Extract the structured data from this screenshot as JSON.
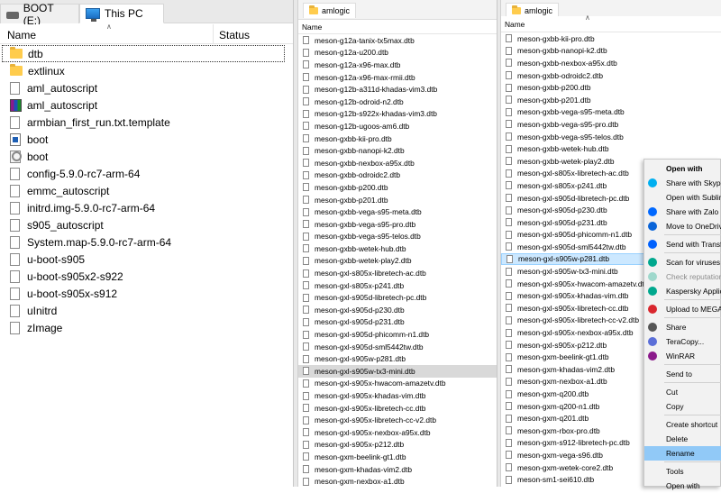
{
  "left": {
    "tabs": [
      "BOOT (E:)",
      "This PC"
    ],
    "columns": [
      "Name",
      "Status"
    ],
    "items": [
      {
        "name": "dtb",
        "type": "folder"
      },
      {
        "name": "extlinux",
        "type": "folder"
      },
      {
        "name": "aml_autoscript",
        "type": "file"
      },
      {
        "name": "aml_autoscript",
        "type": "archive"
      },
      {
        "name": "armbian_first_run.txt.template",
        "type": "file"
      },
      {
        "name": "boot",
        "type": "exe"
      },
      {
        "name": "boot",
        "type": "settings"
      },
      {
        "name": "config-5.9.0-rc7-arm-64",
        "type": "file"
      },
      {
        "name": "emmc_autoscript",
        "type": "file"
      },
      {
        "name": "initrd.img-5.9.0-rc7-arm-64",
        "type": "file"
      },
      {
        "name": "s905_autoscript",
        "type": "file"
      },
      {
        "name": "System.map-5.9.0-rc7-arm-64",
        "type": "file"
      },
      {
        "name": "u-boot-s905",
        "type": "file"
      },
      {
        "name": "u-boot-s905x2-s922",
        "type": "file"
      },
      {
        "name": "u-boot-s905x-s912",
        "type": "file"
      },
      {
        "name": "uInitrd",
        "type": "file"
      },
      {
        "name": "zImage",
        "type": "file"
      }
    ]
  },
  "middle": {
    "tab": "amlogic",
    "column": "Name",
    "items": [
      "meson-g12a-tanix-tx5max.dtb",
      "meson-g12a-u200.dtb",
      "meson-g12a-x96-max.dtb",
      "meson-g12a-x96-max-rmii.dtb",
      "meson-g12b-a311d-khadas-vim3.dtb",
      "meson-g12b-odroid-n2.dtb",
      "meson-g12b-s922x-khadas-vim3.dtb",
      "meson-g12b-ugoos-am6.dtb",
      "meson-gxbb-kii-pro.dtb",
      "meson-gxbb-nanopi-k2.dtb",
      "meson-gxbb-nexbox-a95x.dtb",
      "meson-gxbb-odroidc2.dtb",
      "meson-gxbb-p200.dtb",
      "meson-gxbb-p201.dtb",
      "meson-gxbb-vega-s95-meta.dtb",
      "meson-gxbb-vega-s95-pro.dtb",
      "meson-gxbb-vega-s95-telos.dtb",
      "meson-gxbb-wetek-hub.dtb",
      "meson-gxbb-wetek-play2.dtb",
      "meson-gxl-s805x-libretech-ac.dtb",
      "meson-gxl-s805x-p241.dtb",
      "meson-gxl-s905d-libretech-pc.dtb",
      "meson-gxl-s905d-p230.dtb",
      "meson-gxl-s905d-p231.dtb",
      "meson-gxl-s905d-phicomm-n1.dtb",
      "meson-gxl-s905d-sml5442tw.dtb",
      "meson-gxl-s905w-p281.dtb",
      "meson-gxl-s905w-tx3-mini.dtb",
      "meson-gxl-s905x-hwacom-amazetv.dtb",
      "meson-gxl-s905x-khadas-vim.dtb",
      "meson-gxl-s905x-libretech-cc.dtb",
      "meson-gxl-s905x-libretech-cc-v2.dtb",
      "meson-gxl-s905x-nexbox-a95x.dtb",
      "meson-gxl-s905x-p212.dtb",
      "meson-gxm-beelink-gt1.dtb",
      "meson-gxm-khadas-vim2.dtb",
      "meson-gxm-nexbox-a1.dtb"
    ],
    "highlighted_index": 27
  },
  "right": {
    "tab": "amlogic",
    "column": "Name",
    "items": [
      "meson-gxbb-kii-pro.dtb",
      "meson-gxbb-nanopi-k2.dtb",
      "meson-gxbb-nexbox-a95x.dtb",
      "meson-gxbb-odroidc2.dtb",
      "meson-gxbb-p200.dtb",
      "meson-gxbb-p201.dtb",
      "meson-gxbb-vega-s95-meta.dtb",
      "meson-gxbb-vega-s95-pro.dtb",
      "meson-gxbb-vega-s95-telos.dtb",
      "meson-gxbb-wetek-hub.dtb",
      "meson-gxbb-wetek-play2.dtb",
      "meson-gxl-s805x-libretech-ac.dtb",
      "meson-gxl-s805x-p241.dtb",
      "meson-gxl-s905d-libretech-pc.dtb",
      "meson-gxl-s905d-p230.dtb",
      "meson-gxl-s905d-p231.dtb",
      "meson-gxl-s905d-phicomm-n1.dtb",
      "meson-gxl-s905d-sml5442tw.dtb",
      "meson-gxl-s905w-p281.dtb",
      "meson-gxl-s905w-tx3-mini.dtb",
      "meson-gxl-s905x-hwacom-amazetv.dtb",
      "meson-gxl-s905x-khadas-vim.dtb",
      "meson-gxl-s905x-libretech-cc.dtb",
      "meson-gxl-s905x-libretech-cc-v2.dtb",
      "meson-gxl-s905x-nexbox-a95x.dtb",
      "meson-gxl-s905x-p212.dtb",
      "meson-gxm-beelink-gt1.dtb",
      "meson-gxm-khadas-vim2.dtb",
      "meson-gxm-nexbox-a1.dtb",
      "meson-gxm-q200.dtb",
      "meson-gxm-q200-n1.dtb",
      "meson-gxm-q201.dtb",
      "meson-gxm-rbox-pro.dtb",
      "meson-gxm-s912-libretech-pc.dtb",
      "meson-gxm-vega-s96.dtb",
      "meson-gxm-wetek-core2.dtb",
      "meson-sm1-sei610.dtb"
    ],
    "selected_index": 18
  },
  "context_menu": {
    "items": [
      {
        "label": "Open with",
        "style": "bold",
        "icon": "",
        "color": ""
      },
      {
        "label": "Share with Skype",
        "style": "",
        "icon": "skype-icon",
        "color": "#00aff0"
      },
      {
        "label": "Open with Sublime Text",
        "style": "",
        "icon": "",
        "color": ""
      },
      {
        "label": "Share with Zalo",
        "style": "",
        "icon": "zalo-icon",
        "color": "#0068ff"
      },
      {
        "label": "Move to OneDrive",
        "style": "",
        "icon": "onedrive-icon",
        "color": "#0a64d8"
      },
      {
        "label": "",
        "style": "sep",
        "icon": "",
        "color": ""
      },
      {
        "label": "Send with Transfer",
        "style": "",
        "icon": "dropbox-icon",
        "color": "#0061fe"
      },
      {
        "label": "",
        "style": "sep",
        "icon": "",
        "color": ""
      },
      {
        "label": "Scan for viruses",
        "style": "",
        "icon": "kaspersky-icon",
        "color": "#00a88e"
      },
      {
        "label": "Check reputation",
        "style": "dis",
        "icon": "kaspersky-icon",
        "color": "#9fd8cc"
      },
      {
        "label": "Kaspersky Application",
        "style": "",
        "icon": "kaspersky-icon",
        "color": "#00a88e"
      },
      {
        "label": "",
        "style": "sep",
        "icon": "",
        "color": ""
      },
      {
        "label": "Upload to MEGA",
        "style": "",
        "icon": "mega-icon",
        "color": "#d9272e"
      },
      {
        "label": "",
        "style": "sep",
        "icon": "",
        "color": ""
      },
      {
        "label": "Share",
        "style": "",
        "icon": "share-icon",
        "color": "#555555"
      },
      {
        "label": "TeraCopy...",
        "style": "",
        "icon": "teracopy-icon",
        "color": "#5b6fd8"
      },
      {
        "label": "WinRAR",
        "style": "",
        "icon": "winrar-icon",
        "color": "#8b1a8b"
      },
      {
        "label": "",
        "style": "sep",
        "icon": "",
        "color": ""
      },
      {
        "label": "Send to",
        "style": "",
        "icon": "",
        "color": ""
      },
      {
        "label": "",
        "style": "sep",
        "icon": "",
        "color": ""
      },
      {
        "label": "Cut",
        "style": "",
        "icon": "",
        "color": ""
      },
      {
        "label": "Copy",
        "style": "",
        "icon": "",
        "color": ""
      },
      {
        "label": "",
        "style": "sep",
        "icon": "",
        "color": ""
      },
      {
        "label": "Create shortcut",
        "style": "",
        "icon": "",
        "color": ""
      },
      {
        "label": "Delete",
        "style": "",
        "icon": "",
        "color": ""
      },
      {
        "label": "Rename",
        "style": "hover",
        "icon": "",
        "color": ""
      },
      {
        "label": "",
        "style": "sep",
        "icon": "",
        "color": ""
      },
      {
        "label": "Tools",
        "style": "",
        "icon": "",
        "color": ""
      },
      {
        "label": "Open with",
        "style": "",
        "icon": "",
        "color": ""
      }
    ]
  }
}
